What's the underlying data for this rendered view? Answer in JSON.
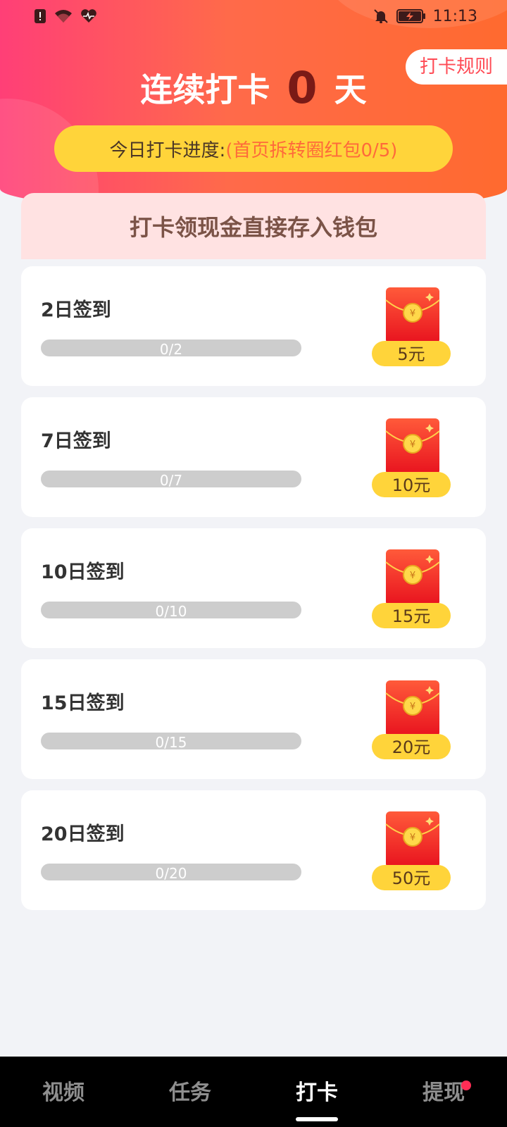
{
  "status_bar": {
    "time": "11:13"
  },
  "header": {
    "rules_label": "打卡规则",
    "streak_prefix": "连续打卡",
    "streak_days": "0",
    "streak_suffix": "天",
    "today_progress_label": "今日打卡进度:",
    "today_progress_detail": "(首页拆转圈红包0/5)"
  },
  "banner": {
    "title": "打卡领现金直接存入钱包"
  },
  "cards": [
    {
      "title": "2日签到",
      "progress_text": "0/2",
      "progress": 0,
      "reward": "5元"
    },
    {
      "title": "7日签到",
      "progress_text": "0/7",
      "progress": 0,
      "reward": "10元"
    },
    {
      "title": "10日签到",
      "progress_text": "0/10",
      "progress": 0,
      "reward": "15元"
    },
    {
      "title": "15日签到",
      "progress_text": "0/15",
      "progress": 0,
      "reward": "20元"
    },
    {
      "title": "20日签到",
      "progress_text": "0/20",
      "progress": 0,
      "reward": "50元"
    }
  ],
  "bottom_nav": {
    "items": [
      {
        "label": "视频"
      },
      {
        "label": "任务"
      },
      {
        "label": "打卡"
      },
      {
        "label": "提现"
      }
    ],
    "active": "打卡"
  },
  "colors": {
    "accent": "#ff4b55",
    "progress_pill": "#ffd43a",
    "reward_badge": "#ffd43a",
    "progress_track": "#cdcdcd"
  },
  "icons": {
    "status_left": [
      "alert-icon",
      "wifi-icon",
      "heart-rate-icon"
    ],
    "status_right": [
      "notifications-off-icon",
      "battery-charging-icon"
    ],
    "reward": "red-envelope-icon"
  }
}
